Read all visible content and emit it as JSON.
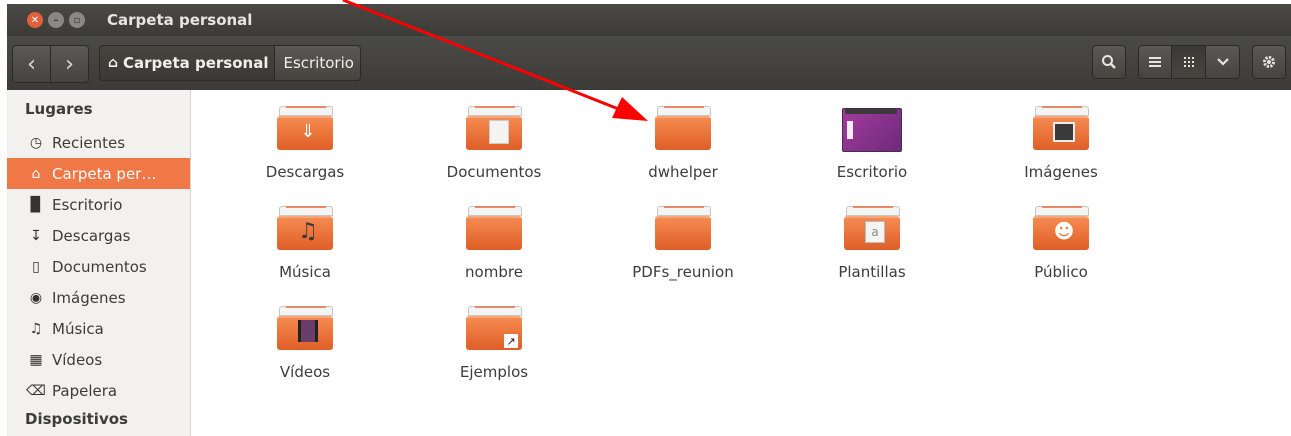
{
  "window": {
    "title": "Carpeta personal"
  },
  "toolbar": {
    "back": "‹",
    "forward": "›",
    "breadcrumb": [
      {
        "label": "Carpeta personal",
        "icon": "home-icon",
        "active": true
      },
      {
        "label": "Escritorio",
        "active": false
      }
    ],
    "buttons": [
      "search-icon",
      "list-view-icon",
      "grid-view-icon",
      "chevron-down-icon",
      "gear-icon"
    ]
  },
  "sidebar": {
    "heading": "Lugares",
    "items": [
      {
        "label": "Recientes",
        "icon": "clock-icon"
      },
      {
        "label": "Carpeta per…",
        "icon": "home-icon",
        "active": true
      },
      {
        "label": "Escritorio",
        "icon": "folder-icon"
      },
      {
        "label": "Descargas",
        "icon": "download-icon"
      },
      {
        "label": "Documentos",
        "icon": "document-icon"
      },
      {
        "label": "Imágenes",
        "icon": "camera-icon"
      },
      {
        "label": "Música",
        "icon": "music-icon"
      },
      {
        "label": "Vídeos",
        "icon": "film-icon"
      },
      {
        "label": "Papelera",
        "icon": "trash-icon"
      }
    ],
    "heading2": "Dispositivos"
  },
  "files": [
    {
      "label": "Descargas",
      "emblem": "download-icon"
    },
    {
      "label": "Documentos",
      "emblem": "document-icon"
    },
    {
      "label": "dwhelper",
      "emblem": "none"
    },
    {
      "label": "Escritorio",
      "emblem": "desktop-icon"
    },
    {
      "label": "Imágenes",
      "emblem": "picture-icon"
    },
    {
      "label": "Música",
      "emblem": "music-icon"
    },
    {
      "label": "nombre",
      "emblem": "none"
    },
    {
      "label": "PDFs_reunion",
      "emblem": "none"
    },
    {
      "label": "Plantillas",
      "emblem": "template-icon"
    },
    {
      "label": "Público",
      "emblem": "person-icon"
    },
    {
      "label": "Vídeos",
      "emblem": "film-icon"
    },
    {
      "label": "Ejemplos",
      "emblem": "link-arrow-icon"
    }
  ],
  "annotation": {
    "color": "#ff0000"
  }
}
